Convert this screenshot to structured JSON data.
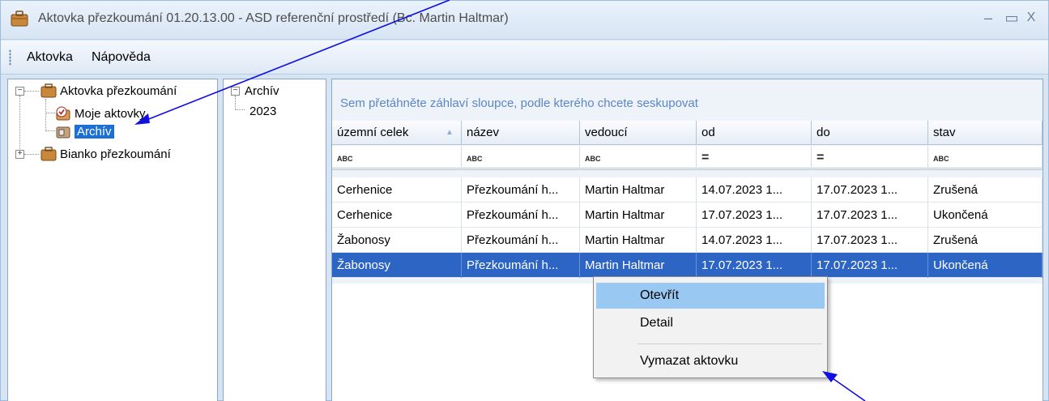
{
  "window": {
    "title": "Aktovka přezkoumání 01.20.13.00 - ASD referenční prostředí (Bc. Martin Haltmar)",
    "minimize_glyph": "–",
    "maximize_glyph": "▭",
    "close_glyph": "X"
  },
  "menu": {
    "items": [
      "Aktovka",
      "Nápověda"
    ]
  },
  "tree": {
    "root1": "Aktovka přezkoumání",
    "child1": "Moje aktovky",
    "child2": "Archív",
    "root2": "Bianko přezkoumání"
  },
  "year_tree": {
    "root": "Archív",
    "child": "2023"
  },
  "grid": {
    "group_hint": "Sem přetáhněte záhlaví sloupce, podle kterého chcete seskupovat",
    "columns": [
      "územní celek",
      "název",
      "vedoucí",
      "od",
      "do",
      "stav"
    ],
    "filter_text": "ABC",
    "filter_equals": "=",
    "rows": [
      [
        "Cerhenice",
        "Přezkoumání h...",
        "Martin Haltmar",
        "14.07.2023 1...",
        "17.07.2023 1...",
        "Zrušená"
      ],
      [
        "Cerhenice",
        "Přezkoumání h...",
        "Martin Haltmar",
        "17.07.2023 1...",
        "17.07.2023 1...",
        "Ukončená"
      ],
      [
        "Žabonosy",
        "Přezkoumání h...",
        "Martin Haltmar",
        "14.07.2023 1...",
        "17.07.2023 1...",
        "Zrušená"
      ],
      [
        "Žabonosy",
        "Přezkoumání h...",
        "Martin Haltmar",
        "17.07.2023 1...",
        "17.07.2023 1...",
        "Ukončená"
      ]
    ],
    "selected_row": 3
  },
  "context_menu": {
    "items": [
      "Otevřít",
      "Detail",
      "Vymazat aktovku"
    ],
    "highlighted": 0
  },
  "colors": {
    "selection": "#2d65c4",
    "menu_hover": "#99c9f2",
    "arrow": "#1010e0",
    "hint": "#5c86c5"
  }
}
